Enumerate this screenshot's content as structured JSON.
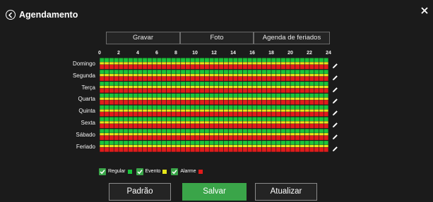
{
  "window": {
    "title": "Agendamento"
  },
  "tabs": [
    {
      "label": "Gravar",
      "active": true
    },
    {
      "label": "Foto",
      "active": false
    },
    {
      "label": "Agenda de feriados",
      "active": false
    }
  ],
  "hour_labels": [
    "0",
    "2",
    "4",
    "6",
    "8",
    "10",
    "12",
    "14",
    "16",
    "18",
    "20",
    "22",
    "24"
  ],
  "days": [
    {
      "label": "Domingo"
    },
    {
      "label": "Segunda"
    },
    {
      "label": "Terça"
    },
    {
      "label": "Quarta"
    },
    {
      "label": "Quinta"
    },
    {
      "label": "Sexta"
    },
    {
      "label": "Sábado"
    },
    {
      "label": "Feriado"
    }
  ],
  "schedule": {
    "slots_per_day": 48,
    "rows_per_day": [
      "Regular",
      "Evento",
      "Alarme"
    ],
    "all_slots_enabled": true
  },
  "legend": [
    {
      "label": "Regular",
      "color": "#19c43a",
      "checked": true
    },
    {
      "label": "Evento",
      "color": "#e6e619",
      "checked": true
    },
    {
      "label": "Alarme",
      "color": "#e11b1b",
      "checked": true
    }
  ],
  "buttons": {
    "default_label": "Padrão",
    "save_label": "Salvar",
    "refresh_label": "Atualizar"
  },
  "colors": {
    "accent": "#3aa549",
    "background": "#1b1b1b"
  }
}
